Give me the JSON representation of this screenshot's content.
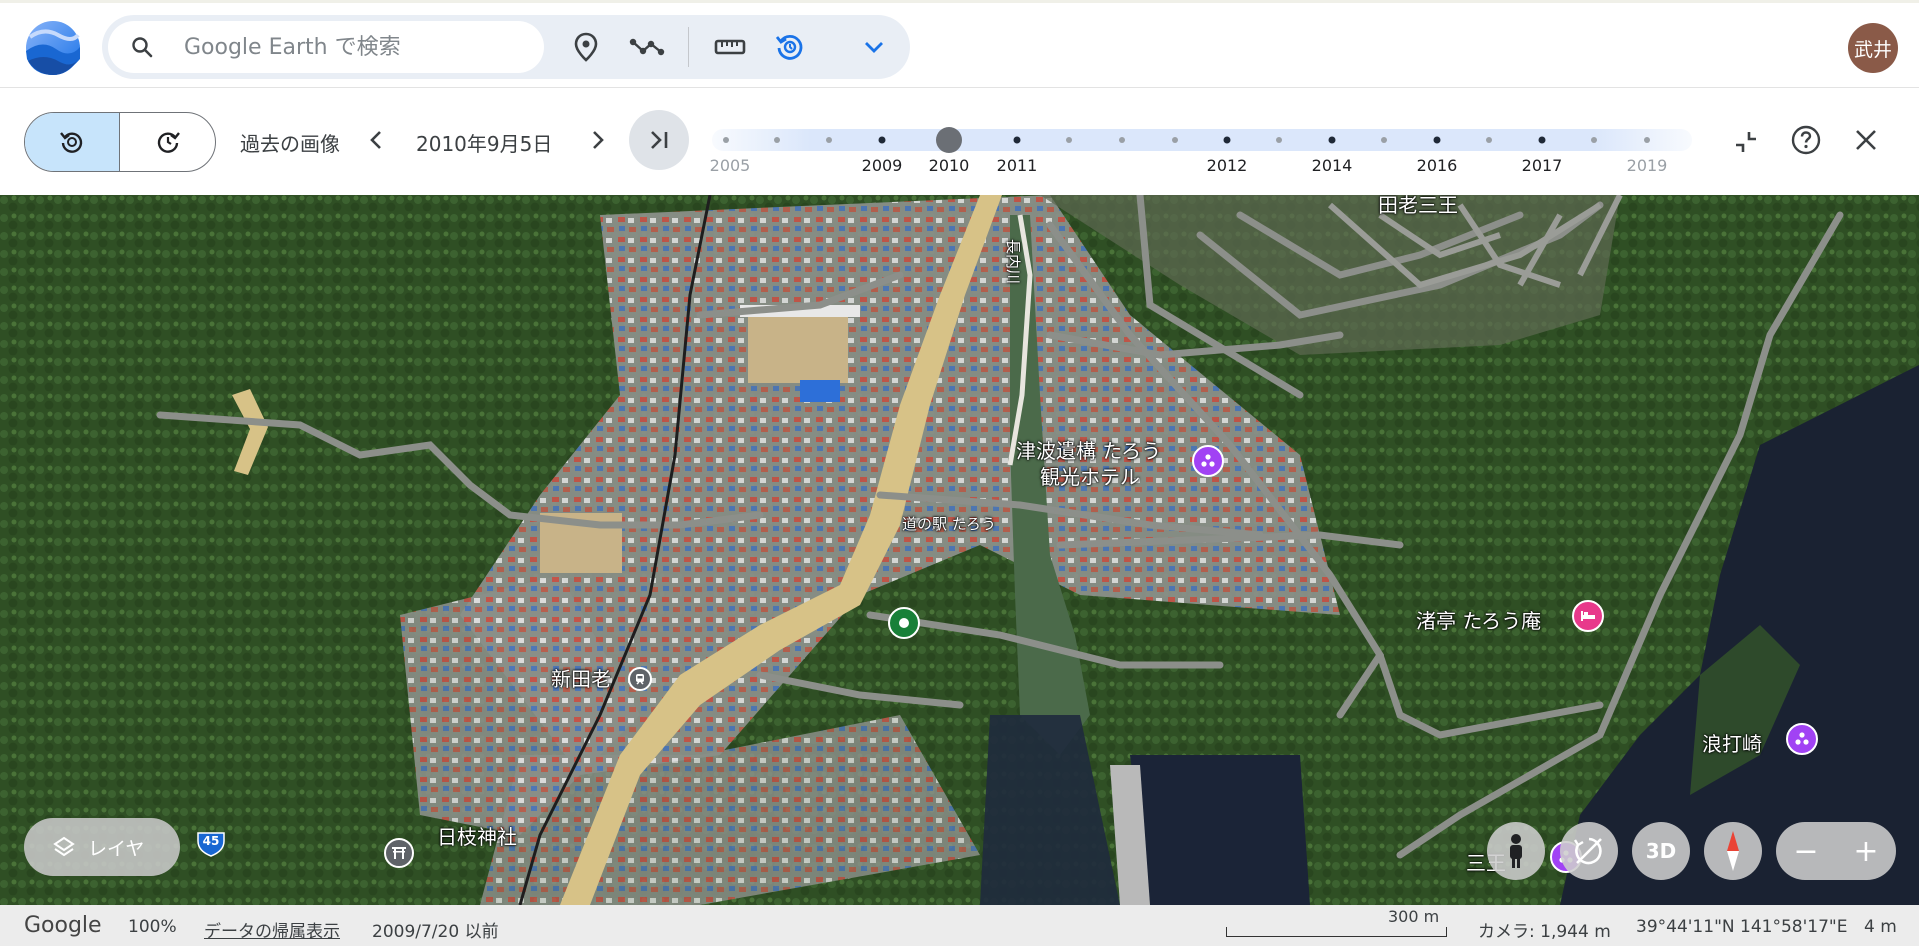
{
  "app": {
    "search_placeholder": "Google Earth で検索",
    "avatar_initials": "武井",
    "accent": "#1a73e8"
  },
  "toolbar": {
    "icons": [
      "search-icon",
      "location-pin-icon",
      "measure-path-icon",
      "ruler-icon",
      "historical-imagery-icon",
      "chevron-down-icon"
    ]
  },
  "history": {
    "title": "過去の画像",
    "current_date": "2010年9月5日",
    "timeline": {
      "labels": [
        {
          "text": "2005",
          "faded": true
        },
        {
          "text": "2009"
        },
        {
          "text": "2010"
        },
        {
          "text": "2011"
        },
        {
          "text": "2012"
        },
        {
          "text": "2014"
        },
        {
          "text": "2016"
        },
        {
          "text": "2017"
        },
        {
          "text": "2019",
          "faded": true
        }
      ],
      "selected": "2010"
    }
  },
  "map": {
    "labels": {
      "district_north": "田老三王",
      "river": "長内川",
      "landmark_1_line1": "津波遺構 たろう",
      "landmark_1_line2": "観光ホテル",
      "michi_no_eki": "道の駅 たろう",
      "station": "新田老",
      "shrine": "日枝神社",
      "inn": "渚亭 たろう庵",
      "cape": "浪打崎",
      "district_south": "三王",
      "route_shield": "45"
    }
  },
  "controls": {
    "layers_label": "レイヤ",
    "btn_3d": "3D",
    "zoom_out": "−",
    "zoom_in": "+"
  },
  "footer": {
    "google": "Google",
    "zoom": "100%",
    "data_attribution": "データの帰属表示",
    "imagery_date": "2009/7/20 以前",
    "scale": "300 m",
    "camera": "カメラ: 1,944 m",
    "coords": "39°44'11\"N 141°58'17\"E",
    "elevation": "4 m"
  }
}
